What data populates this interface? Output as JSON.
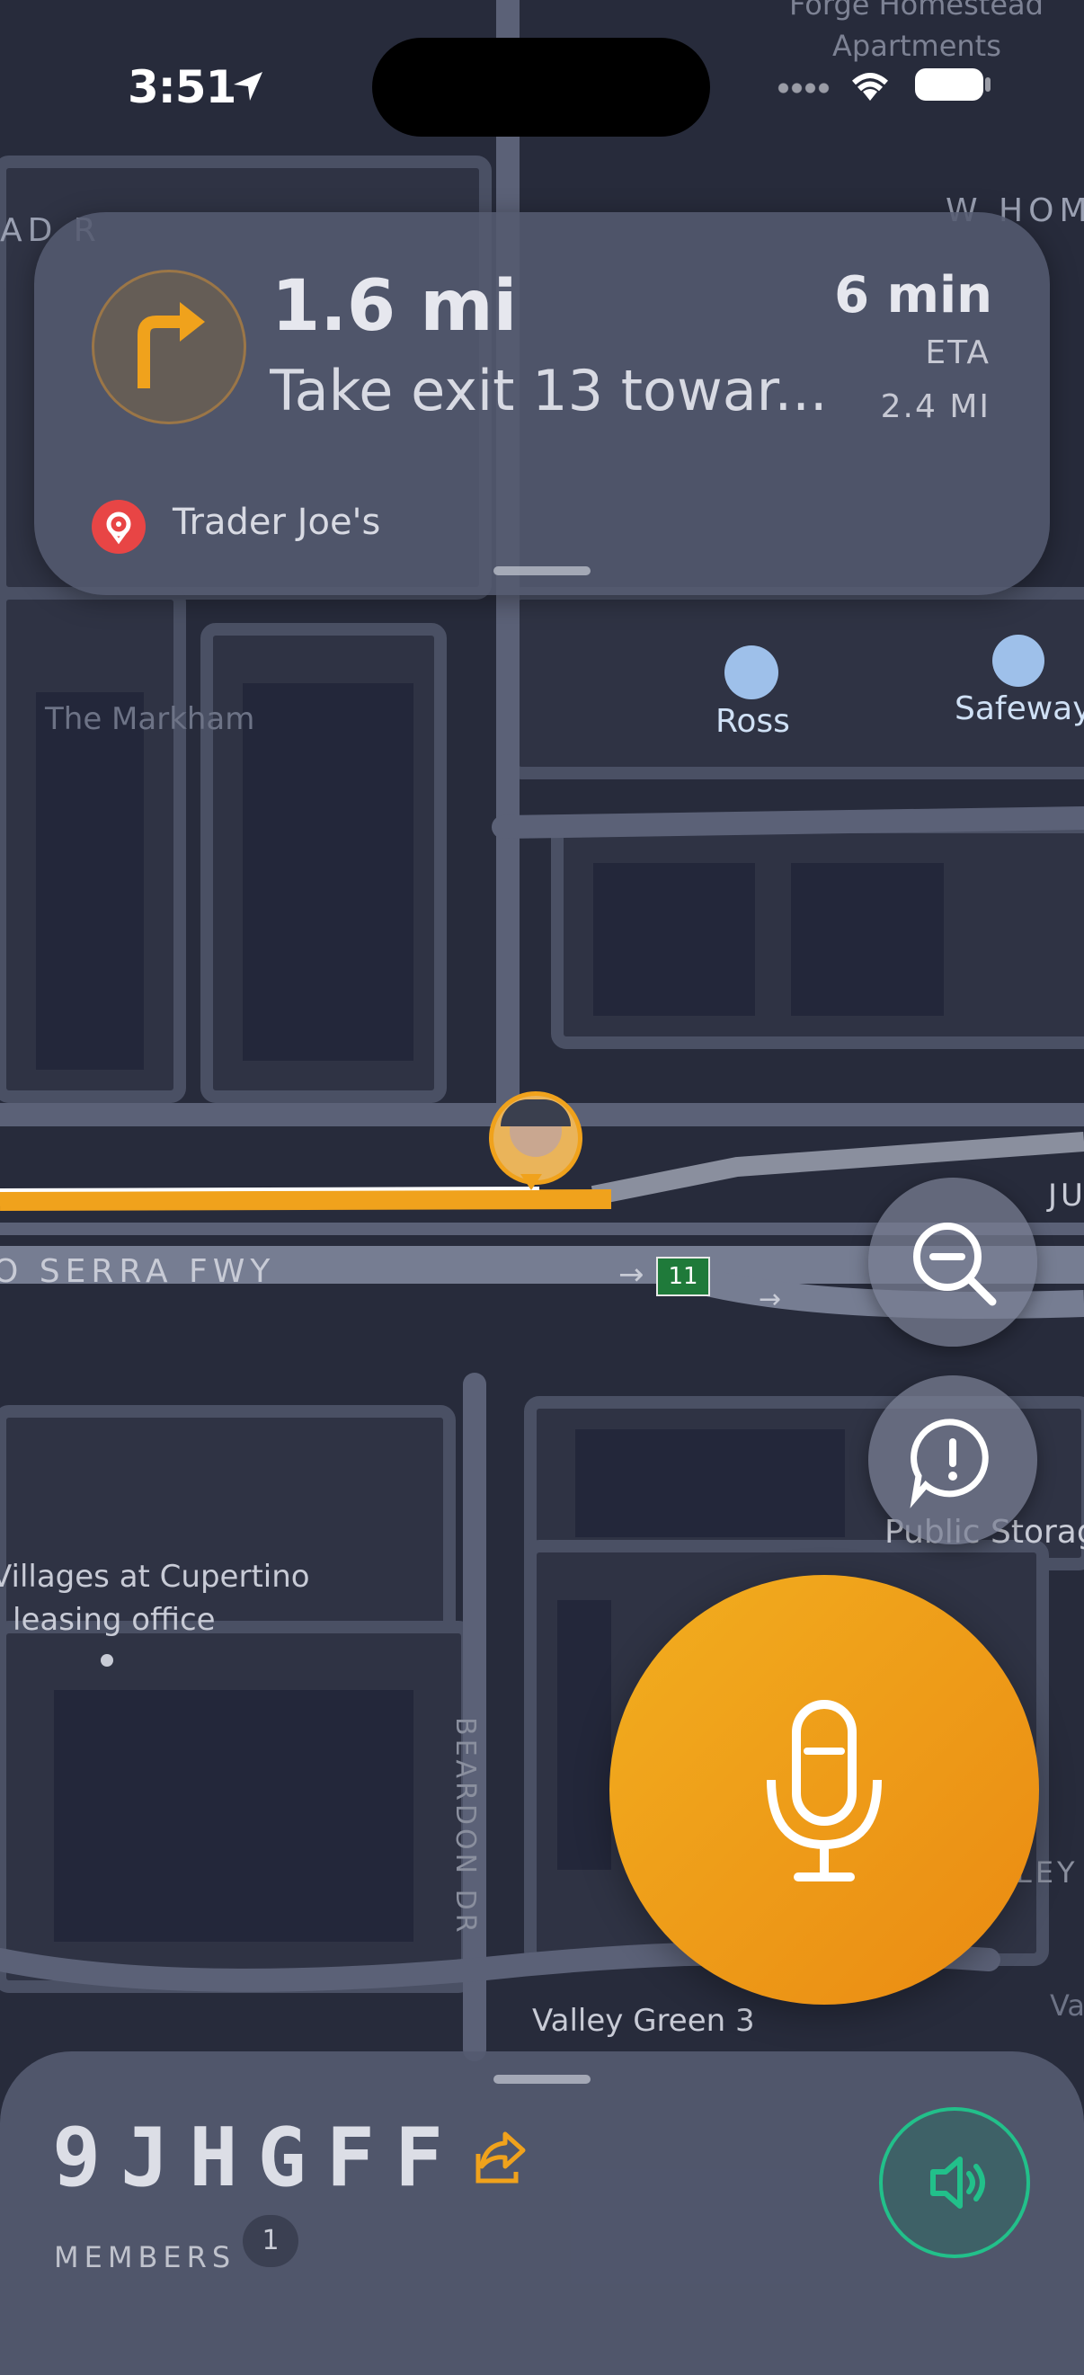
{
  "status_bar": {
    "time": "3:51"
  },
  "navigation": {
    "distance": "1.6 mi",
    "instruction": "Take exit 13 towar...",
    "eta_minutes": "6 min",
    "eta_label": "ETA",
    "remaining_distance": "2.4 MI",
    "destination": "Trader Joe's"
  },
  "map_labels": {
    "forge_homestead": "Forge Homestead",
    "apartments": "Apartments",
    "w_hom": "W HOM",
    "ad": "AD R",
    "markham": "The Markham",
    "ross": "Ross",
    "safeway": "Safeway",
    "serra_fwy": "O SERRA FWY",
    "exit_number": "11",
    "ju": "JU",
    "villages": "Villages at Cupertino",
    "leasing": "leasing office",
    "public_storage": "Public Storag",
    "beardon": "BEARDON DR",
    "valley_green": "Valley Green 3",
    "ley": "LEY",
    "vall": "Vall"
  },
  "session": {
    "code": "9JHGFF",
    "members_label": "MEMBERS",
    "members_count": "1"
  },
  "colors": {
    "accent": "#f0a21c",
    "route": "#f0a21c",
    "speaker_ring": "#22c08a",
    "destination_pin": "#e84545"
  }
}
